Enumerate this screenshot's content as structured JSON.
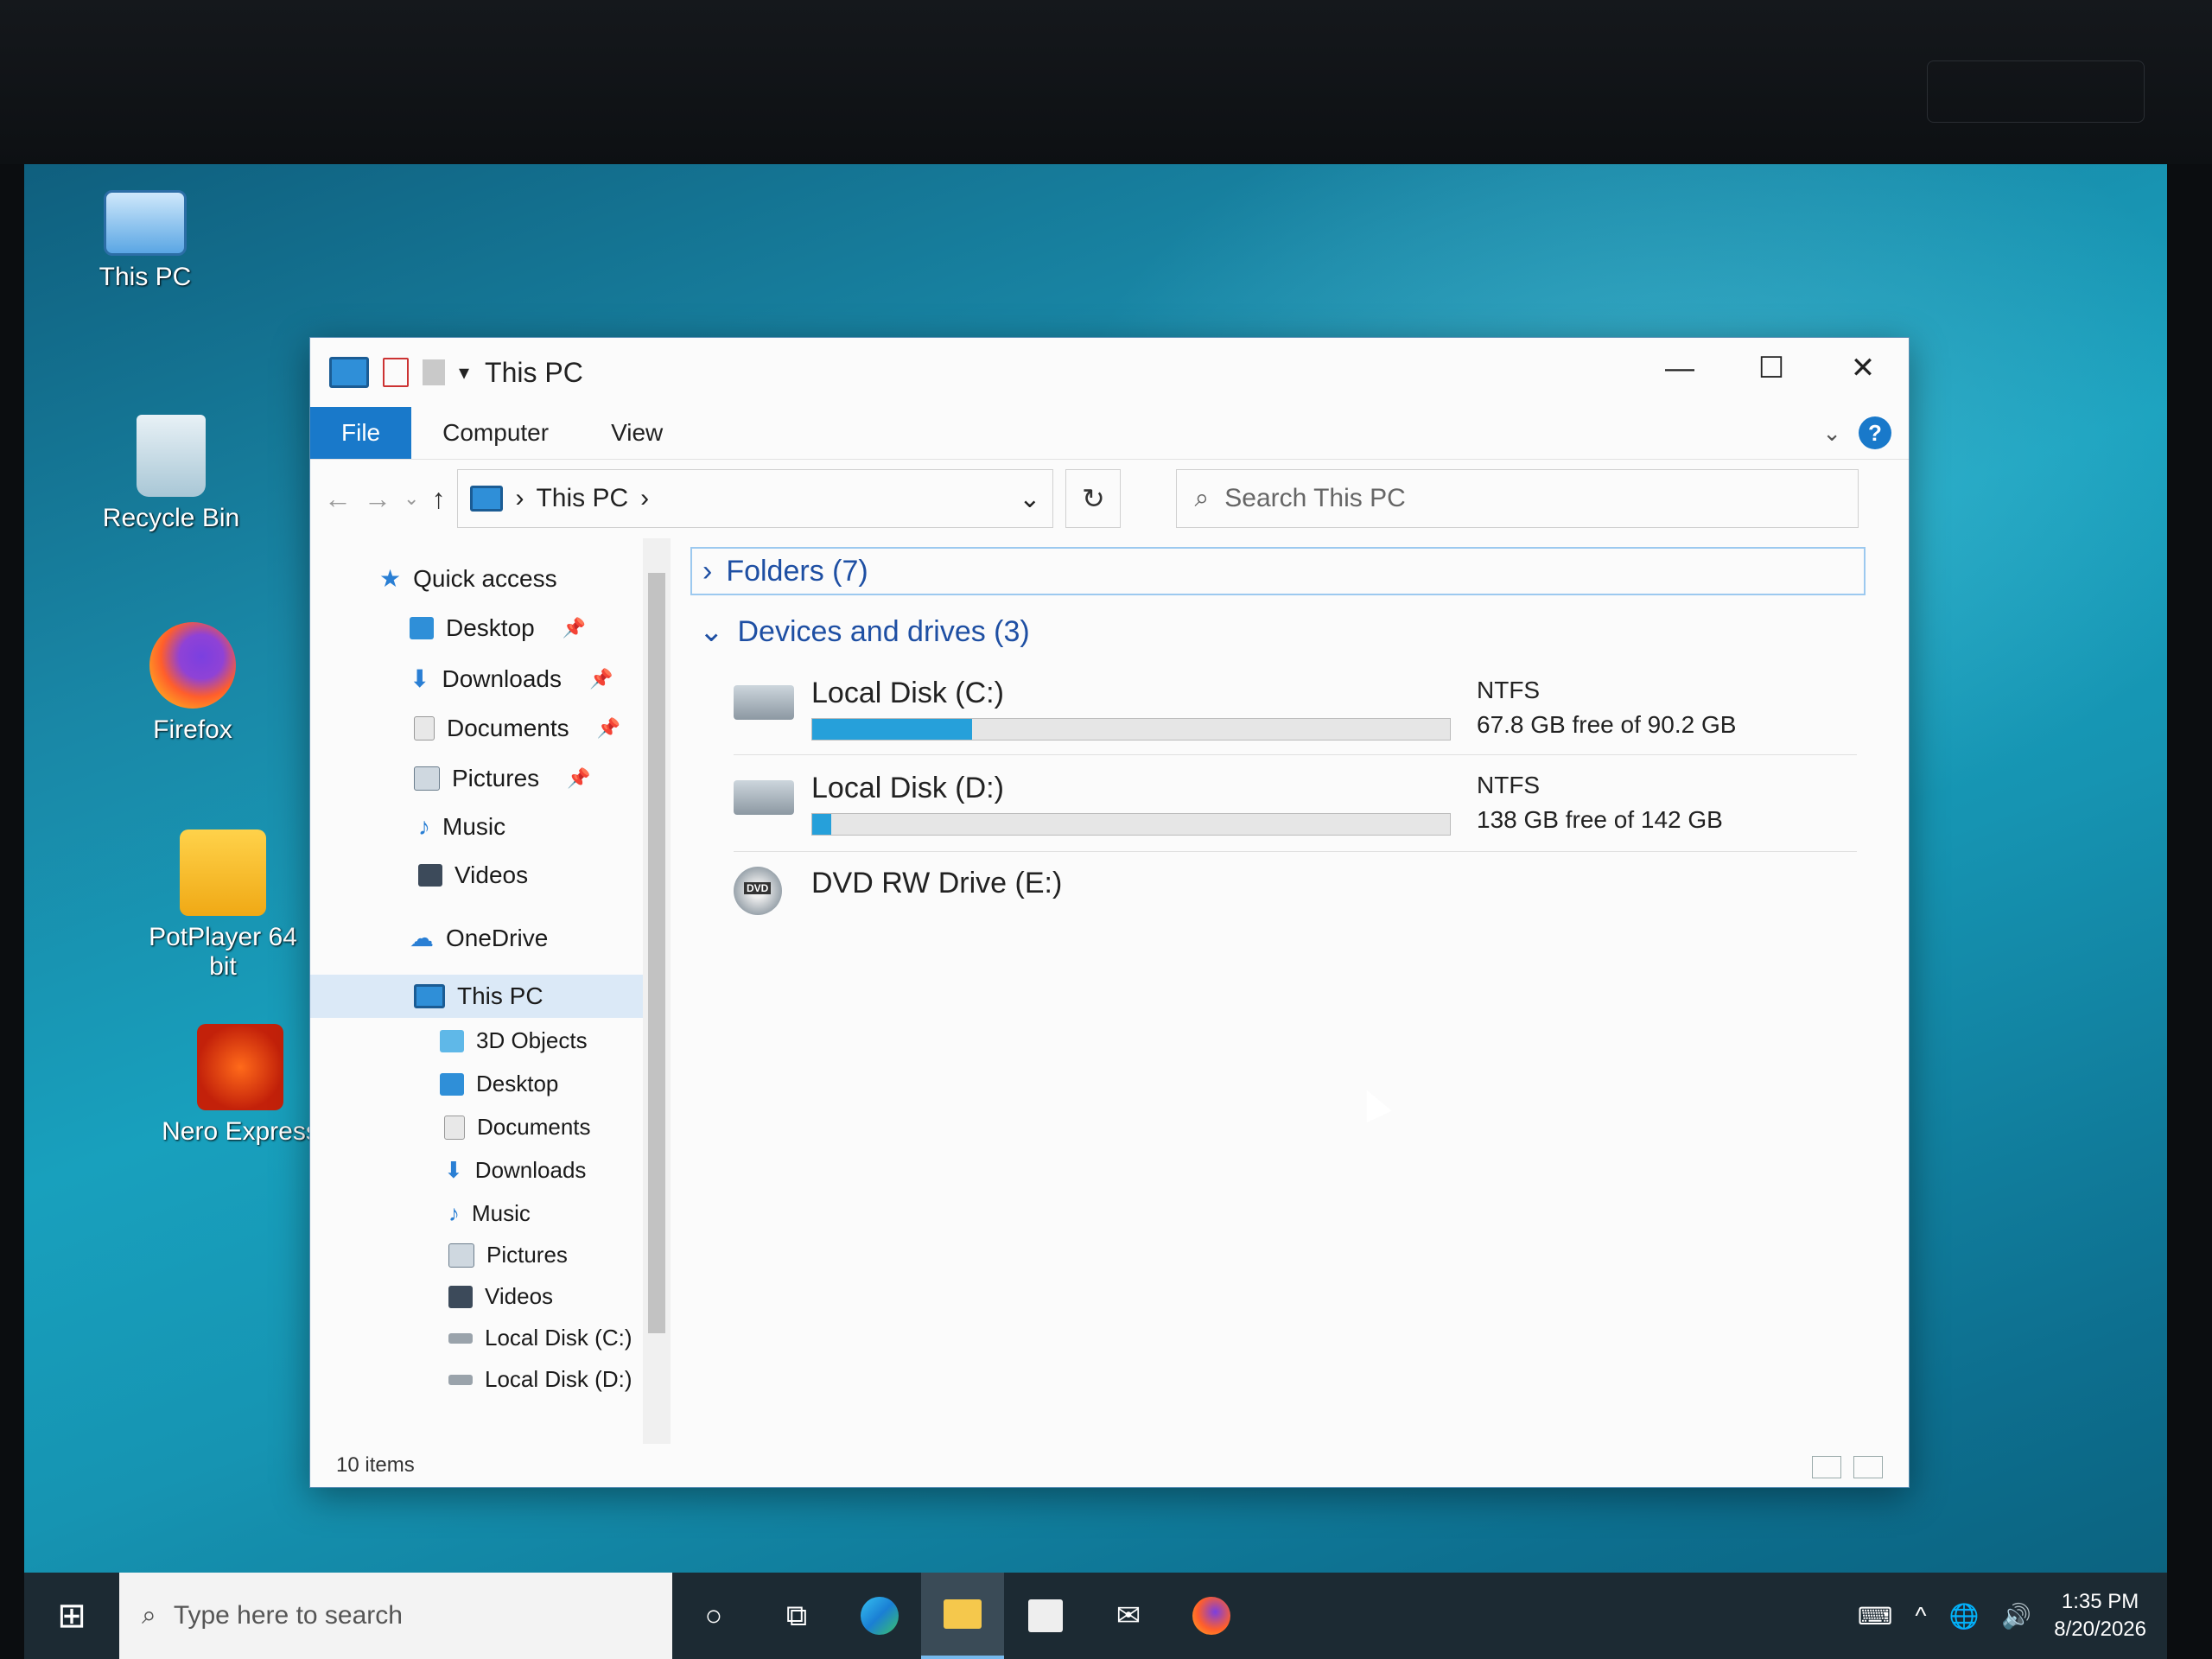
{
  "desktop": {
    "icons": [
      {
        "label": "This PC",
        "icon": "this-pc-icon"
      },
      {
        "label": "Recycle Bin",
        "icon": "recycle-bin-icon"
      },
      {
        "label": "Firefox",
        "icon": "firefox-icon"
      },
      {
        "label": "PotPlayer 64 bit",
        "icon": "potplayer-icon"
      },
      {
        "label": "Nero Express",
        "icon": "nero-express-icon"
      }
    ],
    "wallpaper_color": "#1790ae"
  },
  "window": {
    "title": "This PC",
    "controls": {
      "minimize": "—",
      "maximize": "☐",
      "close": "✕"
    }
  },
  "ribbon": {
    "tabs": [
      "File",
      "Computer",
      "View"
    ],
    "accent": "#1979ca",
    "help": "?"
  },
  "navbar": {
    "back": "←",
    "forward": "→",
    "recent": "⌄",
    "up": "↑",
    "address": "This PC",
    "address_sep": "›",
    "address_dropdown": "⌄",
    "refresh": "↻",
    "search_placeholder": "Search This PC"
  },
  "nav_pane": {
    "quick_access": "Quick access",
    "quick_items": [
      "Desktop",
      "Downloads",
      "Documents",
      "Pictures",
      "Music",
      "Videos"
    ],
    "onedrive": "OneDrive",
    "this_pc": "This PC",
    "this_pc_items": [
      "3D Objects",
      "Desktop",
      "Documents",
      "Downloads",
      "Music",
      "Pictures",
      "Videos",
      "Local Disk (C:)",
      "Local Disk (D:)"
    ]
  },
  "content": {
    "folders_group": "Folders (7)",
    "devices_group": "Devices and drives (3)",
    "drives": [
      {
        "name": "Local Disk (C:)",
        "fs": "NTFS",
        "free": "67.8 GB free of 90.2 GB",
        "used_fraction": 0.25
      },
      {
        "name": "Local Disk (D:)",
        "fs": "NTFS",
        "free": "138 GB free of 142 GB",
        "used_fraction": 0.03
      },
      {
        "name": "DVD RW Drive (E:)",
        "badge": "DVD"
      }
    ],
    "bar_color": "#26a0da"
  },
  "status": {
    "items": "10 items"
  },
  "taskbar": {
    "search_placeholder": "Type here to search",
    "time": "1:35 PM",
    "date": "8/20/2026"
  }
}
